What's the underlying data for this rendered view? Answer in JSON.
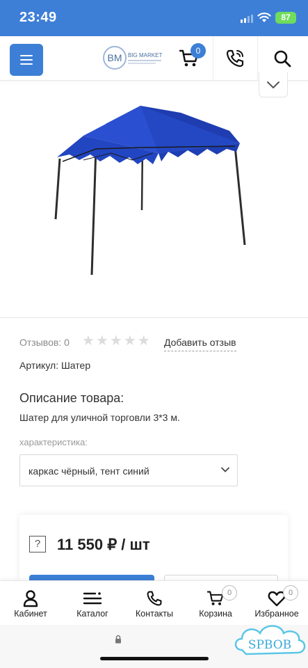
{
  "status_bar": {
    "time": "23:49",
    "battery": "87"
  },
  "header": {
    "logo_initials": "BM",
    "logo_name": "BIG MARKET",
    "cart_count": "0",
    "accent_color": "#3d7fd6"
  },
  "product": {
    "image_alt": "canopy-tent",
    "reviews_label": "Отзывов: 0",
    "rating": 0,
    "rating_max": 5,
    "add_review_label": "Добавить отзыв",
    "sku": "Артикул: Шатер",
    "description_title": "Описание товара:",
    "description_text": "Шатер для уличной торговли 3*3 м.",
    "characteristic_label": "характеристика:",
    "characteristic_value": "каркас чёрный, тент синий",
    "help_mark": "?",
    "price": "11 550 ₽ / шт"
  },
  "bottom_nav": {
    "items": [
      {
        "label": "Кабинет",
        "icon": "user-icon"
      },
      {
        "label": "Каталог",
        "icon": "menu-icon"
      },
      {
        "label": "Контакты",
        "icon": "phone-icon"
      },
      {
        "label": "Корзина",
        "icon": "cart-icon",
        "badge": "0"
      },
      {
        "label": "Избранное",
        "icon": "heart-icon",
        "badge": "0"
      }
    ]
  },
  "watermark": {
    "text": "SPBOB"
  }
}
